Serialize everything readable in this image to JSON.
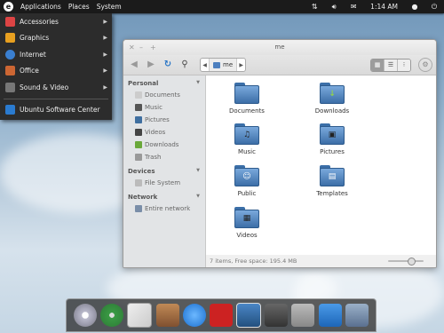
{
  "top_panel": {
    "logo_glyph": "e",
    "menus": [
      "Applications",
      "Places",
      "System"
    ],
    "time": "1:14 AM",
    "tray_icons": [
      "network-icon",
      "volume-icon",
      "mail-icon",
      "user-icon",
      "power-icon"
    ]
  },
  "app_menu": {
    "items": [
      {
        "label": "Accessories",
        "icon": "accessories-icon",
        "color": "#d44"
      },
      {
        "label": "Graphics",
        "icon": "graphics-icon",
        "color": "#e8a020"
      },
      {
        "label": "Internet",
        "icon": "internet-icon",
        "color": "#3a7fd0"
      },
      {
        "label": "Office",
        "icon": "office-icon",
        "color": "#c63"
      },
      {
        "label": "Sound & Video",
        "icon": "sound-video-icon",
        "color": "#777"
      }
    ],
    "footer_item": {
      "label": "Ubuntu Software Center",
      "icon": "software-center-icon",
      "color": "#2a7bd0"
    }
  },
  "window": {
    "title": "me",
    "path": "me",
    "status": "7 items, Free space: 195.4 MB",
    "sidebar": {
      "personal_header": "Personal",
      "personal_items": [
        "Documents",
        "Music",
        "Pictures",
        "Videos",
        "Downloads",
        "Trash"
      ],
      "devices_header": "Devices",
      "devices_items": [
        "File System"
      ],
      "network_header": "Network",
      "network_items": [
        "Entire network"
      ]
    },
    "folders": [
      {
        "label": "Documents",
        "emblem": ""
      },
      {
        "label": "Downloads",
        "emblem": "↓"
      },
      {
        "label": "Music",
        "emblem": "♫"
      },
      {
        "label": "Pictures",
        "emblem": "▣"
      },
      {
        "label": "Public",
        "emblem": "☺"
      },
      {
        "label": "Templates",
        "emblem": "▤"
      },
      {
        "label": "Videos",
        "emblem": "▦"
      }
    ]
  },
  "dock": {
    "items": [
      "disc-burner-icon",
      "safari-compass-icon",
      "mail-icon",
      "contacts-icon",
      "chat-icon",
      "dictionary-icon",
      "photos-icon",
      "text-editor-icon",
      "document-editor-icon",
      "software-center-icon",
      "file-manager-icon"
    ],
    "colors": [
      "#ccd",
      "#3a9a44",
      "#e8e8e8",
      "#a07040",
      "#2a8de0",
      "#c22",
      "#3a6ea8",
      "#555",
      "#888",
      "#2a7bd0",
      "#7a8ea8"
    ]
  }
}
